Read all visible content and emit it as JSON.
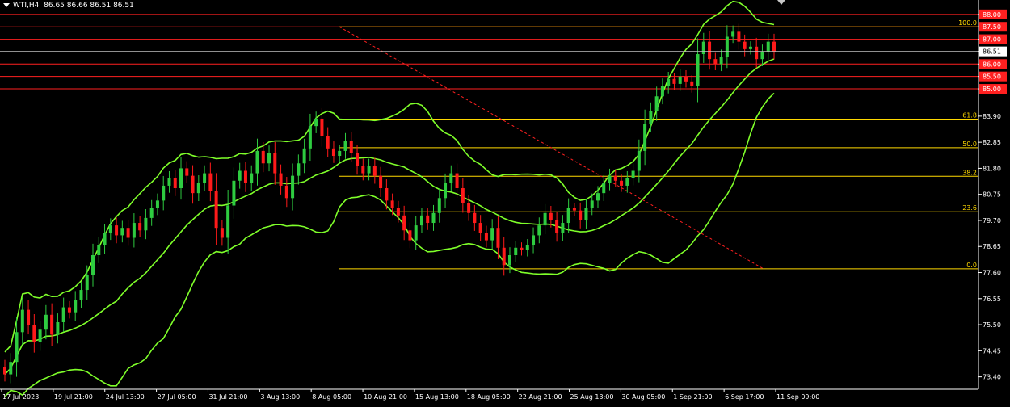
{
  "header": {
    "symbol": "WTI,H4",
    "open": "86.65",
    "high": "86.66",
    "low": "86.51",
    "close": "86.51"
  },
  "colors": {
    "background": "#000000",
    "bull_candle": "#2ecc40",
    "bear_candle": "#ff1a1a",
    "bands": "#7fff2a",
    "fib": "#ffd900",
    "resistance": "#ff2020",
    "trendline": "#ff2020",
    "axis_text": "#ffffff",
    "price_line": "#c0c0c0"
  },
  "chart_data": {
    "type": "candlestick",
    "instrument": "WTI",
    "timeframe": "H4",
    "ylim": [
      72.9,
      88.45
    ],
    "y_ticks": [
      "88.00",
      "87.50",
      "87.00",
      "86.51",
      "86.00",
      "85.50",
      "85.00",
      "83.90",
      "82.85",
      "81.80",
      "80.75",
      "79.70",
      "78.65",
      "77.60",
      "76.55",
      "75.50",
      "74.45",
      "73.40"
    ],
    "x_ticks": [
      "17 Jul 2023",
      "19 Jul 21:00",
      "24 Jul 13:00",
      "27 Jul 05:00",
      "31 Jul 21:00",
      "3 Aug 13:00",
      "8 Aug 05:00",
      "10 Aug 21:00",
      "15 Aug 13:00",
      "18 Aug 05:00",
      "22 Aug 21:00",
      "25 Aug 13:00",
      "30 Aug 05:00",
      "1 Sep 21:00",
      "6 Sep 17:00",
      "11 Sep 09:00"
    ],
    "current_price": "86.51",
    "resistance_levels": [
      {
        "value": 88.0,
        "label": "88.00"
      },
      {
        "value": 87.5,
        "label": "87.50"
      },
      {
        "value": 87.0,
        "label": "87.00"
      },
      {
        "value": 86.0,
        "label": "86.00"
      },
      {
        "value": 85.5,
        "label": "85.50"
      },
      {
        "value": 85.0,
        "label": "85.00"
      }
    ],
    "fibonacci_levels": [
      {
        "label": "100.0",
        "value": 87.5
      },
      {
        "label": "61.8",
        "value": 83.78
      },
      {
        "label": "50.0",
        "value": 82.63
      },
      {
        "label": "38.2",
        "value": 81.48
      },
      {
        "label": "23.6",
        "value": 80.05
      },
      {
        "label": "0.0",
        "value": 77.75
      }
    ],
    "close_path": [
      73.5,
      74.0,
      75.2,
      76.1,
      75.5,
      74.8,
      75.3,
      75.9,
      75.1,
      75.6,
      76.2,
      76.0,
      76.5,
      76.9,
      77.5,
      78.3,
      78.7,
      79.2,
      79.5,
      79.1,
      79.4,
      79.0,
      79.6,
      79.3,
      79.8,
      80.2,
      80.5,
      81.1,
      81.4,
      81.0,
      81.8,
      81.5,
      80.8,
      81.2,
      81.6,
      80.9,
      79.4,
      79.0,
      80.3,
      81.3,
      81.7,
      81.2,
      81.6,
      82.5,
      82.0,
      82.4,
      81.6,
      81.1,
      80.6,
      81.5,
      82.0,
      82.6,
      83.5,
      83.8,
      83.1,
      82.6,
      82.3,
      82.5,
      82.9,
      82.4,
      81.9,
      81.6,
      81.9,
      81.5,
      81.0,
      80.5,
      80.2,
      79.9,
      79.3,
      78.9,
      79.5,
      79.9,
      79.6,
      80.0,
      80.6,
      81.2,
      81.6,
      81.0,
      80.4,
      80.0,
      79.6,
      79.2,
      78.9,
      79.4,
      78.6,
      77.9,
      78.3,
      78.6,
      78.5,
      78.7,
      79.1,
      79.5,
      80.0,
      79.7,
      79.2,
      79.6,
      80.2,
      80.1,
      79.7,
      80.2,
      80.5,
      80.8,
      81.2,
      81.5,
      81.3,
      81.1,
      81.4,
      81.7,
      82.5,
      83.6,
      84.1,
      84.7,
      85.1,
      85.4,
      85.2,
      85.5,
      85.3,
      85.1,
      86.4,
      86.9,
      86.2,
      86.0,
      86.3,
      87.1,
      87.3,
      86.9,
      86.6,
      86.7,
      86.2,
      86.5,
      86.9,
      86.51
    ]
  }
}
